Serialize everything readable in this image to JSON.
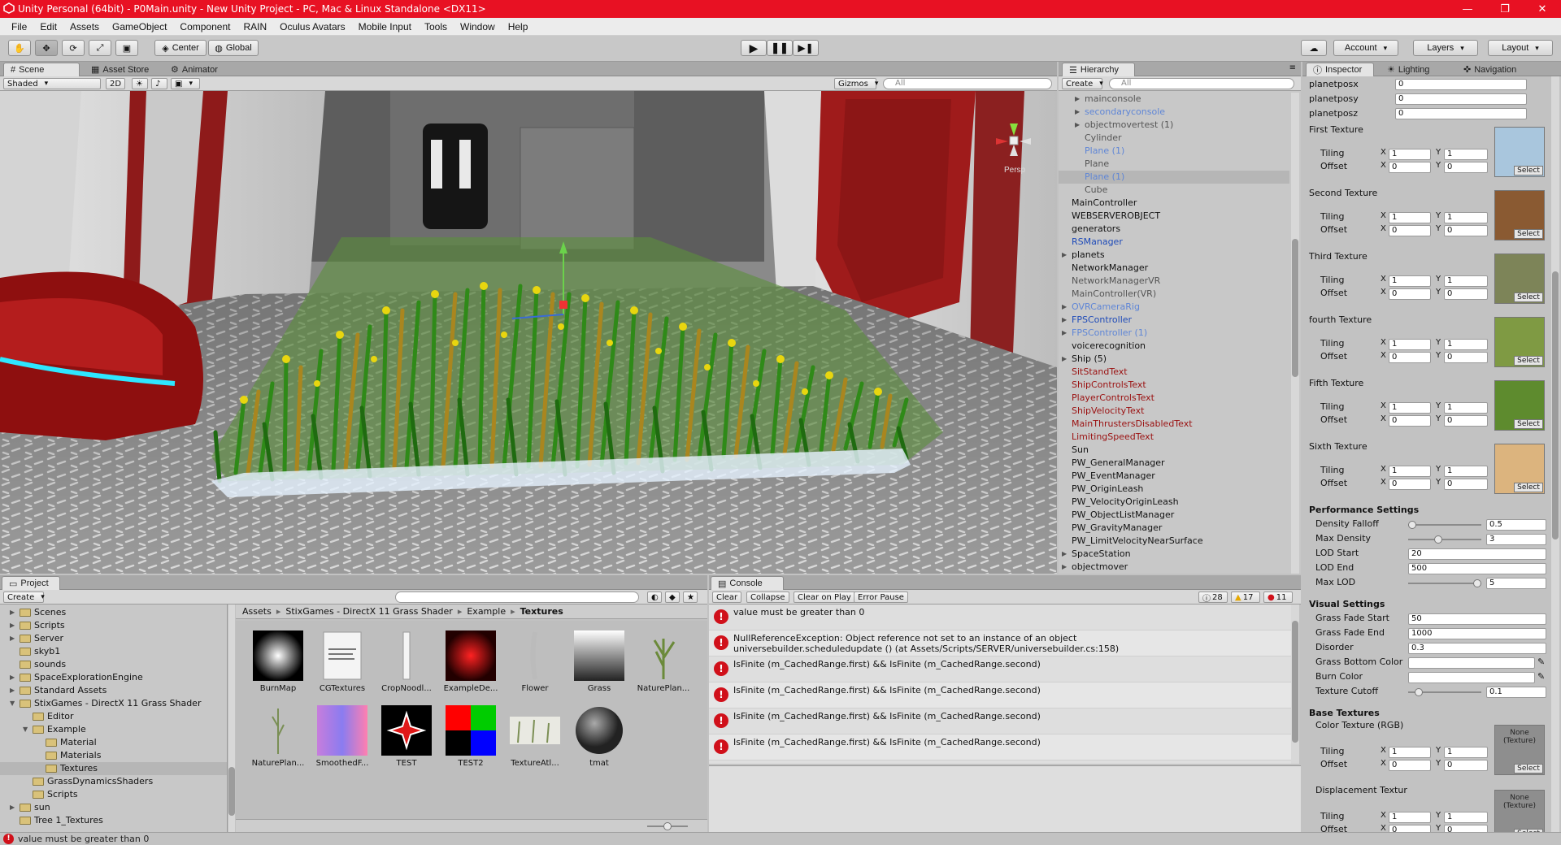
{
  "window": {
    "title": "Unity Personal (64bit) - P0Main.unity - New Unity Project - PC, Mac & Linux Standalone <DX11>"
  },
  "menu": [
    "File",
    "Edit",
    "Assets",
    "GameObject",
    "Component",
    "RAIN",
    "Oculus Avatars",
    "Mobile Input",
    "Tools",
    "Window",
    "Help"
  ],
  "toolbar": {
    "center": "Center",
    "global": "Global",
    "account": "Account",
    "layers": "Layers",
    "layout": "Layout"
  },
  "scene": {
    "tabs": [
      "Scene",
      "Asset Store",
      "Animator"
    ],
    "shading": "Shaded",
    "mode2d": "2D",
    "gizmos": "Gizmos",
    "search": "All",
    "persp": "Persp"
  },
  "hierarchy": {
    "tab": "Hierarchy",
    "create": "Create",
    "search": "All",
    "items": [
      {
        "label": "mainconsole",
        "cls": "grey",
        "indent": 2,
        "arrow": true
      },
      {
        "label": "secondaryconsole",
        "cls": "lblue",
        "indent": 2,
        "arrow": true
      },
      {
        "label": "objectmovertest (1)",
        "cls": "grey",
        "indent": 2,
        "arrow": true
      },
      {
        "label": "Cylinder",
        "cls": "grey",
        "indent": 2,
        "arrow": false
      },
      {
        "label": "Plane (1)",
        "cls": "lblue",
        "indent": 2,
        "arrow": false
      },
      {
        "label": "Plane",
        "cls": "grey",
        "indent": 2,
        "arrow": false
      },
      {
        "label": "Plane (1)",
        "cls": "lblue",
        "indent": 2,
        "arrow": false,
        "selected": true
      },
      {
        "label": "Cube",
        "cls": "grey",
        "indent": 2,
        "arrow": false
      },
      {
        "label": "MainController",
        "cls": "",
        "indent": 1,
        "arrow": false
      },
      {
        "label": "WEBSERVEROBJECT",
        "cls": "",
        "indent": 1,
        "arrow": false
      },
      {
        "label": "generators",
        "cls": "",
        "indent": 1,
        "arrow": false
      },
      {
        "label": "RSManager",
        "cls": "blue",
        "indent": 1,
        "arrow": false
      },
      {
        "label": "planets",
        "cls": "",
        "indent": 1,
        "arrow": true
      },
      {
        "label": "NetworkManager",
        "cls": "",
        "indent": 1,
        "arrow": false
      },
      {
        "label": "NetworkManagerVR",
        "cls": "grey",
        "indent": 1,
        "arrow": false
      },
      {
        "label": "MainController(VR)",
        "cls": "grey",
        "indent": 1,
        "arrow": false
      },
      {
        "label": "OVRCameraRig",
        "cls": "lblue",
        "indent": 1,
        "arrow": true
      },
      {
        "label": "FPSController",
        "cls": "blue",
        "indent": 1,
        "arrow": true
      },
      {
        "label": "FPSController (1)",
        "cls": "lblue",
        "indent": 1,
        "arrow": true
      },
      {
        "label": "voicerecognition",
        "cls": "",
        "indent": 1,
        "arrow": false
      },
      {
        "label": "Ship (5)",
        "cls": "",
        "indent": 1,
        "arrow": true
      },
      {
        "label": "SitStandText",
        "cls": "red",
        "indent": 1,
        "arrow": false
      },
      {
        "label": "ShipControlsText",
        "cls": "red",
        "indent": 1,
        "arrow": false
      },
      {
        "label": "PlayerControlsText",
        "cls": "red",
        "indent": 1,
        "arrow": false
      },
      {
        "label": "ShipVelocityText",
        "cls": "red",
        "indent": 1,
        "arrow": false
      },
      {
        "label": "MainThrustersDisabledText",
        "cls": "red",
        "indent": 1,
        "arrow": false
      },
      {
        "label": "LimitingSpeedText",
        "cls": "red",
        "indent": 1,
        "arrow": false
      },
      {
        "label": "Sun",
        "cls": "",
        "indent": 1,
        "arrow": false
      },
      {
        "label": "PW_GeneralManager",
        "cls": "",
        "indent": 1,
        "arrow": false
      },
      {
        "label": "PW_EventManager",
        "cls": "",
        "indent": 1,
        "arrow": false
      },
      {
        "label": "PW_OriginLeash",
        "cls": "",
        "indent": 1,
        "arrow": false
      },
      {
        "label": "PW_VelocityOriginLeash",
        "cls": "",
        "indent": 1,
        "arrow": false
      },
      {
        "label": "PW_ObjectListManager",
        "cls": "",
        "indent": 1,
        "arrow": false
      },
      {
        "label": "PW_GravityManager",
        "cls": "",
        "indent": 1,
        "arrow": false
      },
      {
        "label": "PW_LimitVelocityNearSurface",
        "cls": "",
        "indent": 1,
        "arrow": false
      },
      {
        "label": "SpaceStation",
        "cls": "",
        "indent": 1,
        "arrow": true
      },
      {
        "label": "objectmover",
        "cls": "",
        "indent": 1,
        "arrow": true
      }
    ]
  },
  "inspector": {
    "tabs": [
      "Inspector",
      "Lighting",
      "Navigation"
    ],
    "pos": [
      {
        "label": "planetposx",
        "value": "0"
      },
      {
        "label": "planetposy",
        "value": "0"
      },
      {
        "label": "planetposz",
        "value": "0"
      }
    ],
    "tiling_label": "Tiling",
    "offset_label": "Offset",
    "x": "X",
    "y": "Y",
    "select": "Select",
    "textures": [
      {
        "label": "First Texture",
        "color": "#a9c6dd",
        "tiling": [
          "1",
          "1"
        ],
        "offset": [
          "0",
          "0"
        ]
      },
      {
        "label": "Second Texture",
        "color": "#8a5a32",
        "tiling": [
          "1",
          "1"
        ],
        "offset": [
          "0",
          "0"
        ]
      },
      {
        "label": "Third Texture",
        "color": "#7d8458",
        "tiling": [
          "1",
          "1"
        ],
        "offset": [
          "0",
          "0"
        ]
      },
      {
        "label": "fourth Texture",
        "color": "#7f9a43",
        "tiling": [
          "1",
          "1"
        ],
        "offset": [
          "0",
          "0"
        ]
      },
      {
        "label": "Fifth Texture",
        "color": "#5e8b2e",
        "tiling": [
          "1",
          "1"
        ],
        "offset": [
          "0",
          "0"
        ]
      },
      {
        "label": "Sixth Texture",
        "color": "#dcb47e",
        "tiling": [
          "1",
          "1"
        ],
        "offset": [
          "0",
          "0"
        ]
      }
    ],
    "perf_header": "Performance Settings",
    "perf": [
      {
        "label": "Density Falloff",
        "value": "0.5",
        "slider": 0.0
      },
      {
        "label": "Max Density",
        "value": "3",
        "slider": 0.4
      },
      {
        "label": "LOD Start",
        "value": "20"
      },
      {
        "label": "LOD End",
        "value": "500"
      },
      {
        "label": "Max LOD",
        "value": "5",
        "slider": 1.0
      }
    ],
    "visual_header": "Visual Settings",
    "visual": [
      {
        "label": "Grass Fade Start",
        "value": "50"
      },
      {
        "label": "Grass Fade End",
        "value": "1000"
      },
      {
        "label": "Disorder",
        "value": "0.3"
      },
      {
        "label": "Grass Bottom Color",
        "value": ""
      },
      {
        "label": "Burn Color",
        "value": ""
      },
      {
        "label": "Texture Cutoff",
        "value": "0.1",
        "slider": 0.1
      }
    ],
    "base_header": "Base Textures",
    "color_tex": "Color Texture (RGB)",
    "disp_tex": "Displacement Textur",
    "none_tex": "None (Texture)"
  },
  "project": {
    "tab": "Project",
    "create": "Create",
    "tree": [
      {
        "label": "Scenes",
        "indent": 1,
        "arrow": true
      },
      {
        "label": "Scripts",
        "indent": 1,
        "arrow": true
      },
      {
        "label": "Server",
        "indent": 1,
        "arrow": true
      },
      {
        "label": "skyb1",
        "indent": 1,
        "arrow": false
      },
      {
        "label": "sounds",
        "indent": 1,
        "arrow": false
      },
      {
        "label": "SpaceExplorationEngine",
        "indent": 1,
        "arrow": true
      },
      {
        "label": "Standard Assets",
        "indent": 1,
        "arrow": true
      },
      {
        "label": "StixGames - DirectX 11 Grass Shader",
        "indent": 1,
        "arrow": true,
        "open": true
      },
      {
        "label": "Editor",
        "indent": 2,
        "arrow": false
      },
      {
        "label": "Example",
        "indent": 2,
        "arrow": true,
        "open": true
      },
      {
        "label": "Material",
        "indent": 3,
        "arrow": false
      },
      {
        "label": "Materials",
        "indent": 3,
        "arrow": false
      },
      {
        "label": "Textures",
        "indent": 3,
        "arrow": false,
        "selected": true
      },
      {
        "label": "GrassDynamicsShaders",
        "indent": 2,
        "arrow": false
      },
      {
        "label": "Scripts",
        "indent": 2,
        "arrow": false
      },
      {
        "label": "sun",
        "indent": 1,
        "arrow": true
      },
      {
        "label": "Tree 1_Textures",
        "indent": 1,
        "arrow": false
      }
    ],
    "breadcrumb": [
      "Assets",
      "StixGames - DirectX 11 Grass Shader",
      "Example",
      "Textures"
    ],
    "assets": [
      {
        "label": "BurnMap"
      },
      {
        "label": "CGTextures"
      },
      {
        "label": "CropNoodl..."
      },
      {
        "label": "ExampleDe..."
      },
      {
        "label": "Flower"
      },
      {
        "label": "Grass"
      },
      {
        "label": "NaturePlan..."
      },
      {
        "label": "NaturePlan..."
      },
      {
        "label": "SmoothedF..."
      },
      {
        "label": "TEST"
      },
      {
        "label": "TEST2"
      },
      {
        "label": "TextureAtl..."
      },
      {
        "label": "tmat"
      }
    ]
  },
  "console": {
    "tab": "Console",
    "clear": "Clear",
    "collapse": "Collapse",
    "clear_on_play": "Clear on Play",
    "error_pause": "Error Pause",
    "counts": {
      "info": "28",
      "warn": "17",
      "error": "11"
    },
    "entries": [
      {
        "line1": "value must be greater than 0",
        "line2": ""
      },
      {
        "line1": "NullReferenceException: Object reference not set to an instance of an object",
        "line2": "universebuilder.scheduledupdate () (at Assets/Scripts/SERVER/universebuilder.cs:158)"
      },
      {
        "line1": "IsFinite (m_CachedRange.first) && IsFinite (m_CachedRange.second)",
        "line2": ""
      },
      {
        "line1": "IsFinite (m_CachedRange.first) && IsFinite (m_CachedRange.second)",
        "line2": ""
      },
      {
        "line1": "IsFinite (m_CachedRange.first) && IsFinite (m_CachedRange.second)",
        "line2": ""
      },
      {
        "line1": "IsFinite (m_CachedRange.first) && IsFinite (m_CachedRange.second)",
        "line2": ""
      }
    ]
  },
  "status": {
    "message": "value must be greater than 0"
  }
}
